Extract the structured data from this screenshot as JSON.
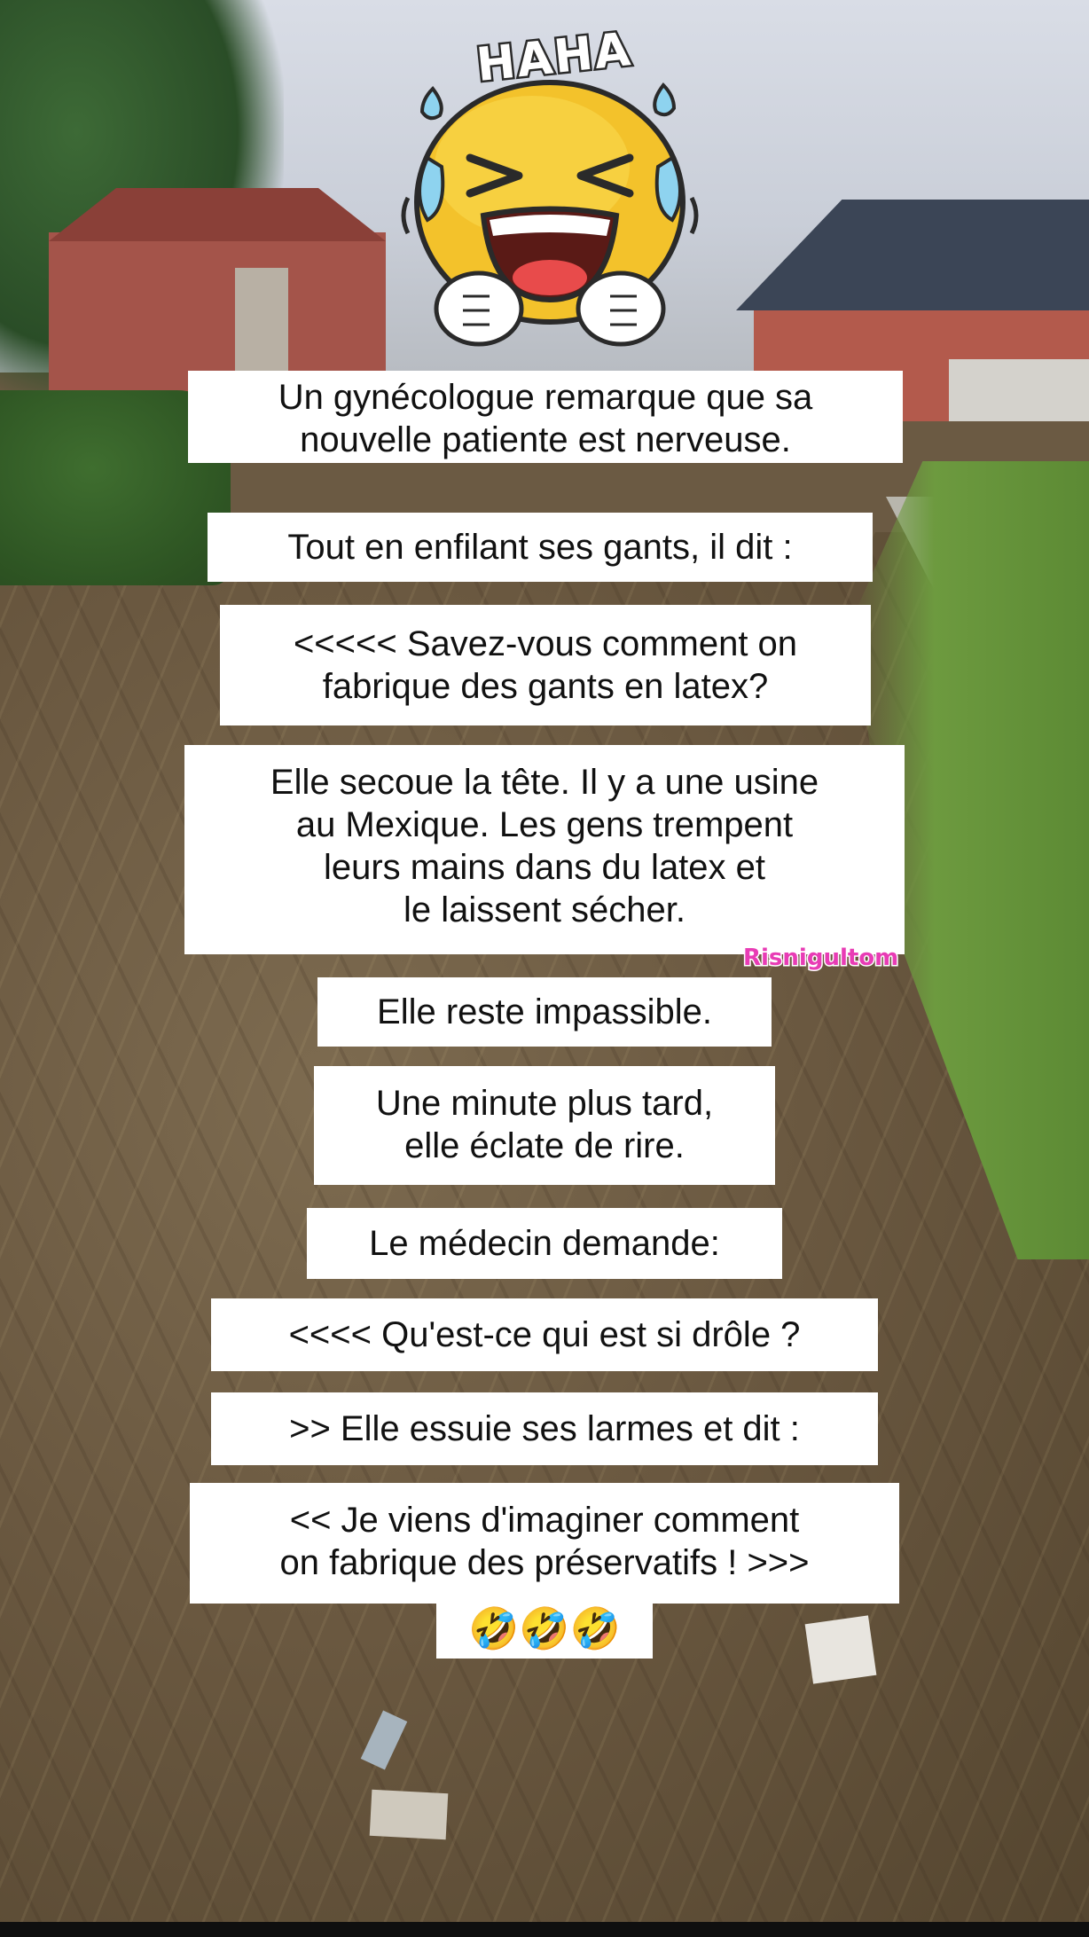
{
  "sticker_text": "HAHA",
  "watermark": "Risnigultom",
  "lines": {
    "l1a": "Un gynécologue remarque que sa",
    "l1b": "nouvelle patiente est nerveuse.",
    "l2": "Tout en enfilant ses gants, il dit :",
    "l3a": "<<<<< Savez-vous comment on",
    "l3b": "fabrique des gants en latex?",
    "l4a": "Elle secoue la tête. Il y a une usine",
    "l4b": "au Mexique. Les gens trempent",
    "l4c": "leurs mains dans du latex et",
    "l4d": "le laissent sécher.",
    "l5": "Elle reste impassible.",
    "l6a": "Une minute plus tard,",
    "l6b": "elle éclate de rire.",
    "l7": "Le médecin demande:",
    "l8": "<<<< Qu'est-ce qui est si drôle ?",
    "l9": ">> Elle essuie ses larmes et dit :",
    "l10a": "<< Je viens d'imaginer comment",
    "l10b": "on fabrique des préservatifs ! >>>",
    "laugh_emojis": "🤣🤣🤣"
  },
  "icons": {
    "sticker": "laughing-face-icon"
  }
}
